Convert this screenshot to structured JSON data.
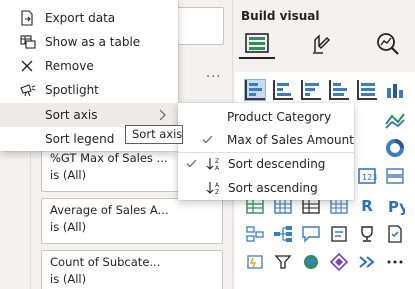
{
  "context_menu": {
    "items": [
      {
        "label": "Export data",
        "icon": "export-data-icon"
      },
      {
        "label": "Show as a table",
        "icon": "table-icon"
      },
      {
        "label": "Remove",
        "icon": "close-icon"
      },
      {
        "label": "Spotlight",
        "icon": "spotlight-icon"
      },
      {
        "label": "Sort axis",
        "icon": "chevron-right-icon"
      },
      {
        "label": "Sort legend",
        "icon": ""
      }
    ]
  },
  "tooltip": "Sort axis",
  "sort_submenu": {
    "fields": [
      {
        "label": "Product Category",
        "checked": false
      },
      {
        "label": "Max of Sales Amount",
        "checked": true
      }
    ],
    "orders": [
      {
        "label": "Sort descending",
        "checked": true,
        "icon": "sort-descending-icon"
      },
      {
        "label": "Sort ascending",
        "checked": false,
        "icon": "sort-ascending-icon"
      }
    ]
  },
  "filters": {
    "more_options": "...",
    "cards": [
      {
        "name": "%GT Max of Sales ...",
        "value": "is (All)"
      },
      {
        "name": "Average of Sales A...",
        "value": "is (All)"
      },
      {
        "name": "Count of Subcate...",
        "value": "is (All)"
      }
    ]
  },
  "build_visual": {
    "title": "Build visual",
    "buttons": [
      "build-visual-icon",
      "format-visual-icon",
      "analytics-icon"
    ]
  }
}
